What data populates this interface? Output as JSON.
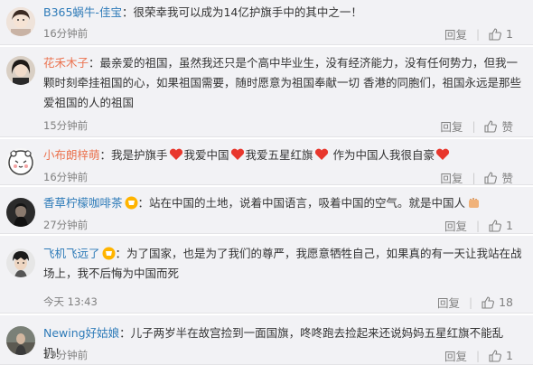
{
  "comments": [
    {
      "username": "B365蜗牛-佳宝",
      "text": "：很荣幸我可以成为14亿护旗手中的其中之一！",
      "time": "16分钟前",
      "reply": "回复",
      "likes": "1"
    },
    {
      "username": "花禾木子",
      "text": "：最亲爱的祖国，虽然我还只是个高中毕业生，没有经济能力，没有任何势力，但我一颗时刻牵挂祖国的心，如果祖国需要，随时愿意为祖国奉献一切 香港的同胞们，祖国永远是那些爱祖国的人的祖国",
      "time": "15分钟前",
      "reply": "回复",
      "likes": "赞"
    },
    {
      "username": "小布朗梓萌",
      "text_parts": [
        "：我是护旗手",
        "我爱中国",
        "我爱五星红旗",
        " 作为中国人我很自豪"
      ],
      "time": "16分钟前",
      "reply": "回复",
      "likes": "赞"
    },
    {
      "username": "香草柠檬咖啡茶",
      "text": "：站在中国的土地，说着中国语言，吸着中国的空气。就是中国人",
      "time": "27分钟前",
      "reply": "回复",
      "likes": "1"
    },
    {
      "username": "飞机飞远了",
      "text": "：为了国家，也是为了我们的尊严，我愿意牺牲自己，如果真的有一天让我站在战场上，我不后悔为中国而死",
      "time": "今天 13:43",
      "reply": "回复",
      "likes": "18"
    },
    {
      "username": "Newing好姑娘",
      "text": "：儿子两岁半在故宫捡到一面国旗，咚咚跑去捡起来还说妈妈五星红旗不能乱扔！",
      "time": "19分钟前",
      "reply": "回复",
      "likes": "1"
    }
  ],
  "colors": {
    "username": "#eb7350",
    "username_blue": "#2e7bb8",
    "heart": "#e8372d",
    "background": "#f2f2f5"
  }
}
